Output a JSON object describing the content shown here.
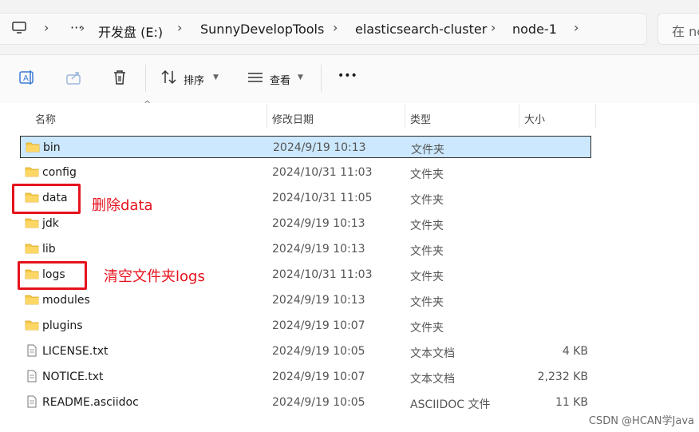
{
  "address": {
    "crumbs": [
      "开发盘 (E:)",
      "SunnyDevelopTools",
      "elasticsearch-cluster",
      "node-1"
    ],
    "overflow": "···",
    "separator": "›",
    "search_placeholder": "在 nc"
  },
  "toolbar": {
    "sort_label": "排序",
    "view_label": "查看",
    "more_label": "•••"
  },
  "columns": {
    "name": "名称",
    "date": "修改日期",
    "type": "类型",
    "size": "大小",
    "sort_indicator": "^"
  },
  "files": [
    {
      "name": "bin",
      "date": "2024/9/19 10:13",
      "type": "文件夹",
      "size": "",
      "kind": "folder",
      "selected": true
    },
    {
      "name": "config",
      "date": "2024/10/31 11:03",
      "type": "文件夹",
      "size": "",
      "kind": "folder"
    },
    {
      "name": "data",
      "date": "2024/10/31 11:05",
      "type": "文件夹",
      "size": "",
      "kind": "folder"
    },
    {
      "name": "jdk",
      "date": "2024/9/19 10:13",
      "type": "文件夹",
      "size": "",
      "kind": "folder"
    },
    {
      "name": "lib",
      "date": "2024/9/19 10:13",
      "type": "文件夹",
      "size": "",
      "kind": "folder"
    },
    {
      "name": "logs",
      "date": "2024/10/31 11:03",
      "type": "文件夹",
      "size": "",
      "kind": "folder"
    },
    {
      "name": "modules",
      "date": "2024/9/19 10:13",
      "type": "文件夹",
      "size": "",
      "kind": "folder"
    },
    {
      "name": "plugins",
      "date": "2024/9/19 10:07",
      "type": "文件夹",
      "size": "",
      "kind": "folder"
    },
    {
      "name": "LICENSE.txt",
      "date": "2024/9/19 10:05",
      "type": "文本文档",
      "size": "4 KB",
      "kind": "text"
    },
    {
      "name": "NOTICE.txt",
      "date": "2024/9/19 10:07",
      "type": "文本文档",
      "size": "2,232 KB",
      "kind": "text"
    },
    {
      "name": "README.asciidoc",
      "date": "2024/9/19 10:05",
      "type": "ASCIIDOC 文件",
      "size": "11 KB",
      "kind": "doc"
    }
  ],
  "annotations": {
    "delete_data": "删除data",
    "clear_logs": "清空文件夹logs"
  },
  "watermark": "CSDN @HCAN学Java",
  "colors": {
    "selection": "#cce8ff",
    "annotation": "#e5131d",
    "folder": "#f7c948"
  }
}
